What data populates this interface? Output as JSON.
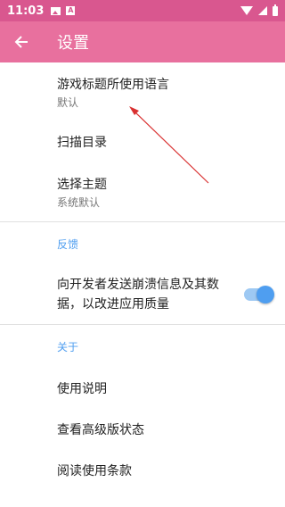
{
  "status_bar": {
    "time": "11:03",
    "notif_a": "A"
  },
  "app_bar": {
    "title": "设置"
  },
  "general": {
    "game_title_language": {
      "title": "游戏标题所使用语言",
      "value": "默认"
    },
    "scan_directory": {
      "title": "扫描目录"
    },
    "choose_theme": {
      "title": "选择主题",
      "value": "系统默认"
    }
  },
  "feedback": {
    "header": "反馈",
    "crash_report": {
      "title": "向开发者发送崩溃信息及其数据，以改进应用质量",
      "enabled": true
    }
  },
  "about": {
    "header": "关于",
    "items": [
      "使用说明",
      "查看高级版状态",
      "阅读使用条款"
    ]
  },
  "colors": {
    "status_bar": "#d9578f",
    "app_bar": "#e8709e",
    "accent": "#4f9ef0",
    "annotation_arrow": "#d93030"
  },
  "icons": [
    "image-notification-icon",
    "a-notification-icon",
    "wifi-icon",
    "cell-signal-icon",
    "battery-icon",
    "back-arrow-icon"
  ]
}
